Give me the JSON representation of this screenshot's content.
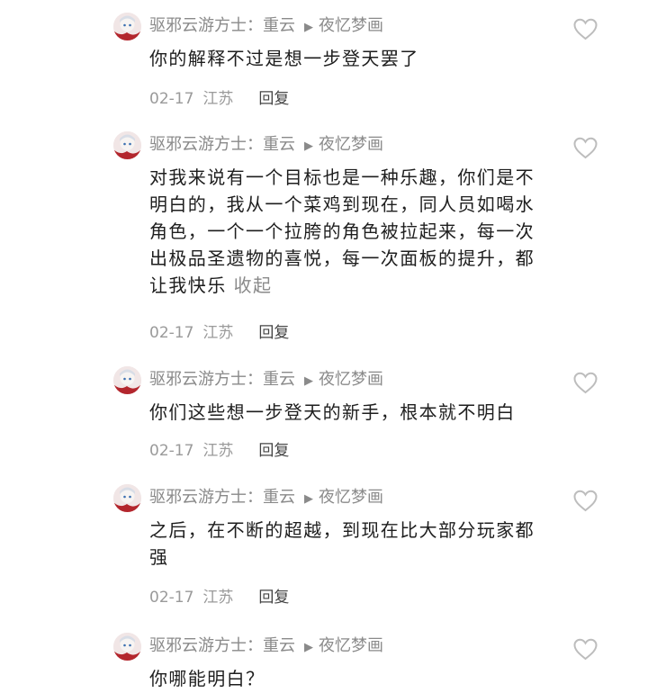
{
  "comments": [
    {
      "user": "驱邪云游方士：",
      "reply_to": "重云",
      "arrow": "▶",
      "target": "夜忆梦画",
      "text": "你的解释不过是想一步登天罢了",
      "date": "02-17",
      "location": "江苏",
      "reply_label": "回复"
    },
    {
      "user": "驱邪云游方士：",
      "reply_to": "重云",
      "arrow": "▶",
      "target": "夜忆梦画",
      "text": "对我来说有一个目标也是一种乐趣，你们是不明白的，我从一个菜鸡到现在，同人员如喝水角色，一个一个拉胯的角色被拉起来，每一次出极品圣遗物的喜悦，每一次面板的提升，都让我快乐",
      "collapse_label": "收起",
      "date": "02-17",
      "location": "江苏",
      "reply_label": "回复"
    },
    {
      "user": "驱邪云游方士：",
      "reply_to": "重云",
      "arrow": "▶",
      "target": "夜忆梦画",
      "text": "你们这些想一步登天的新手，根本就不明白",
      "date": "02-17",
      "location": "江苏",
      "reply_label": "回复"
    },
    {
      "user": "驱邪云游方士：",
      "reply_to": "重云",
      "arrow": "▶",
      "target": "夜忆梦画",
      "text": "之后，在不断的超越，到现在比大部分玩家都强",
      "date": "02-17",
      "location": "江苏",
      "reply_label": "回复"
    },
    {
      "user": "驱邪云游方士：",
      "reply_to": "重云",
      "arrow": "▶",
      "target": "夜忆梦画",
      "text": "你哪能明白？"
    }
  ],
  "icons": {
    "like": "heart-outline-icon",
    "avatar": "anime-avatar"
  },
  "colors": {
    "text": "#1e1e1e",
    "muted": "#8a8a8a",
    "reply": "#444444",
    "heart": "#bdbdbd"
  }
}
